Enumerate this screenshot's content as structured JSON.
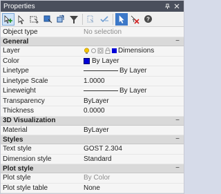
{
  "window": {
    "title": "Properties"
  },
  "rows": {
    "object_type": {
      "label": "Object type",
      "value": "No selection"
    }
  },
  "sections": {
    "general": {
      "title": "General",
      "collapse": "−",
      "layer": {
        "label": "Layer",
        "value": "Dimensions"
      },
      "color": {
        "label": "Color",
        "value": "By Layer"
      },
      "linetype": {
        "label": "Linetype",
        "value": "By Layer"
      },
      "linetype_scale": {
        "label": "Linetype Scale",
        "value": "1.0000"
      },
      "lineweight": {
        "label": "Lineweight",
        "value": "By Layer"
      },
      "transparency": {
        "label": "Transparency",
        "value": "ByLayer"
      },
      "thickness": {
        "label": "Thickness",
        "value": "0.0000"
      }
    },
    "viz3d": {
      "title": "3D Visualization",
      "collapse": "−",
      "material": {
        "label": "Material",
        "value": "ByLayer"
      }
    },
    "styles": {
      "title": "Styles",
      "collapse": "−",
      "text_style": {
        "label": "Text style",
        "value": "GOST 2.304"
      },
      "dimension_style": {
        "label": "Dimension style",
        "value": "Standard"
      }
    },
    "plot_style": {
      "title": "Plot style",
      "collapse": "−",
      "plot_style": {
        "label": "Plot style",
        "value": "By Color"
      },
      "plot_style_table": {
        "label": "Plot style table",
        "value": "None"
      }
    }
  },
  "colors": {
    "titlebar": "#4a4f5c",
    "section": "#d9d9d9",
    "blue_swatch": "#0000d8",
    "selected_tool": "#3c78c8"
  },
  "icons": [
    "pin-icon",
    "close-icon",
    "add-selection-icon",
    "select-objects-icon",
    "quick-select-icon",
    "toggle-pickadd-icon",
    "filter-icon",
    "copy-properties-icon",
    "check-icon",
    "cursor-select-icon",
    "clear-selection-icon",
    "help-icon"
  ]
}
